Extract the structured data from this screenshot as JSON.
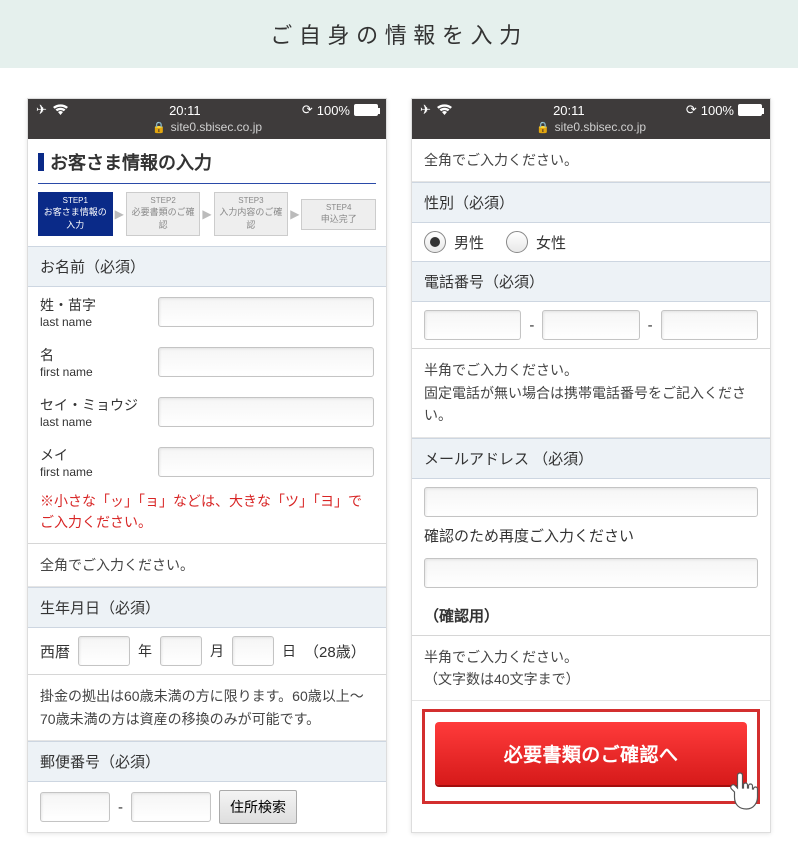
{
  "banner": "ご自身の情報を入力",
  "statusbar": {
    "time": "20:11",
    "battery_pct": "100%",
    "url": "site0.sbisec.co.jp"
  },
  "left": {
    "page_title": "お客さま情報の入力",
    "steps": [
      {
        "n": "STEP1",
        "label": "お客さま情報の入力"
      },
      {
        "n": "STEP2",
        "label": "必要書類のご確認"
      },
      {
        "n": "STEP3",
        "label": "入力内容のご確認"
      },
      {
        "n": "STEP4",
        "label": "申込完了"
      }
    ],
    "name_header": "お名前（必須）",
    "labels": {
      "sei": "姓・苗字",
      "sei_en": "last name",
      "mei": "名",
      "mei_en": "first name",
      "sei_kana": "セイ・ミョウジ",
      "sei_kana_en": "last name",
      "mei_kana": "メイ",
      "mei_kana_en": "first name"
    },
    "kana_note": "※小さな「ッ」「ョ」などは、大きな「ツ」「ヨ」でご入力ください。",
    "zenkaku_note": "全角でご入力ください。",
    "dob_header": "生年月日（必須）",
    "dob": {
      "era": "西暦",
      "year_u": "年",
      "month_u": "月",
      "day_u": "日",
      "age": "（28歳）"
    },
    "age_note": "掛金の拠出は60歳未満の方に限ります。60歳以上〜70歳未満の方は資産の移換のみが可能です。",
    "zip_header": "郵便番号（必須）",
    "zip_btn": "住所検索"
  },
  "right": {
    "zenkaku_note": "全角でご入力ください。",
    "gender_header": "性別（必須）",
    "gender": {
      "male": "男性",
      "female": "女性"
    },
    "phone_header": "電話番号（必須）",
    "phone_note": "半角でご入力ください。\n固定電話が無い場合は携帯電話番号をご記入ください。",
    "email_header": "メールアドレス （必須）",
    "email_confirm_label": "確認のため再度ご入力ください",
    "email_confirm_header": "（確認用）",
    "email_note": "半角でご入力ください。\n（文字数は40文字まで）",
    "cta": "必要書類のご確認へ"
  }
}
